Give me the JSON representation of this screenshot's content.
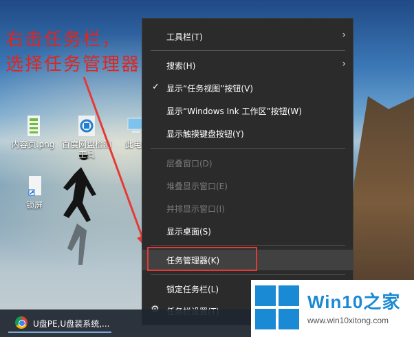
{
  "annotation": {
    "text": "右击任务栏，\n选择任务管理器",
    "color": "#e0261f"
  },
  "desktop_icons": [
    {
      "label": "内容页.png",
      "icon": "png-image-icon"
    },
    {
      "label": "百度网盘检测工具",
      "icon": "baidu-netdisk-tool-icon"
    },
    {
      "label": "此电",
      "icon": "this-pc-icon"
    },
    {
      "label": "锁屏",
      "icon": "lock-screen-shortcut-icon"
    }
  ],
  "context_menu": {
    "items": [
      {
        "label": "工具栏(T)",
        "submenu": true,
        "enabled": true
      },
      {
        "label": "搜索(H)",
        "submenu": true,
        "enabled": true
      },
      {
        "label": "显示“任务视图”按钮(V)",
        "checked": true,
        "enabled": true
      },
      {
        "label": "显示“Windows Ink 工作区”按钮(W)",
        "enabled": true
      },
      {
        "label": "显示触摸键盘按钮(Y)",
        "enabled": true
      },
      {
        "label": "层叠窗口(D)",
        "enabled": false
      },
      {
        "label": "堆叠显示窗口(E)",
        "enabled": false
      },
      {
        "label": "并排显示窗口(I)",
        "enabled": false
      },
      {
        "label": "显示桌面(S)",
        "enabled": true
      },
      {
        "label": "任务管理器(K)",
        "enabled": true,
        "highlighted": true
      },
      {
        "label": "锁定任务栏(L)",
        "enabled": true
      },
      {
        "label": "任务栏设置(T)",
        "enabled": true,
        "icon": "gear-icon"
      }
    ],
    "submenu_arrow": "›",
    "check_mark": "✓",
    "gear_glyph": "⚙"
  },
  "taskbar": {
    "button_label": "U盘PE,U盘装系统,..."
  },
  "watermark": {
    "brand": "Win10",
    "brand_suffix": "之家",
    "url": "www.win10xitong.com",
    "color": "#1a8ad4"
  }
}
